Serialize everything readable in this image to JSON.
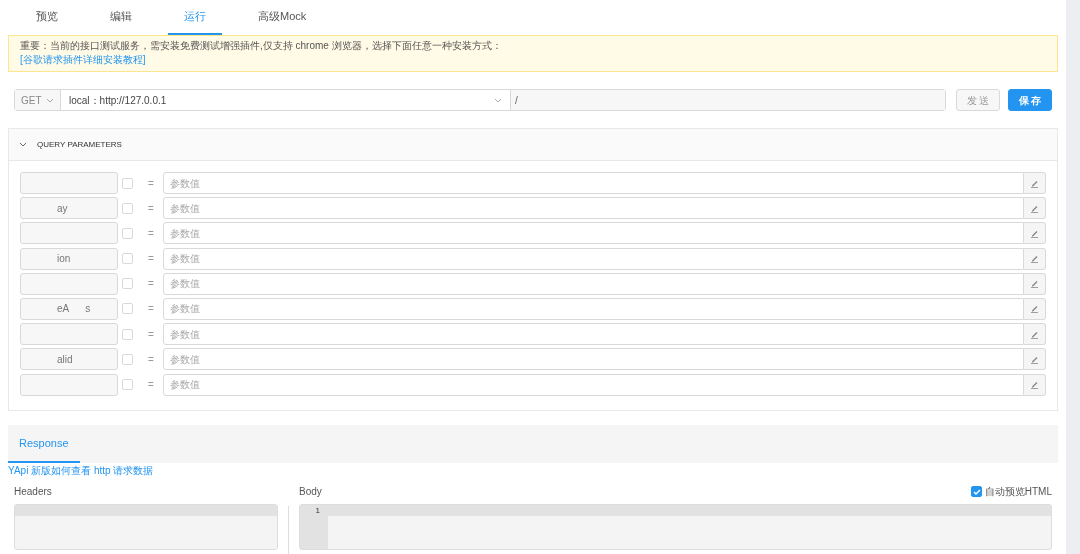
{
  "tabs": [
    {
      "label": "预览",
      "selected": false
    },
    {
      "label": "编辑",
      "selected": false
    },
    {
      "label": "运行",
      "selected": true
    },
    {
      "label": "高级Mock",
      "selected": false
    }
  ],
  "notice": {
    "text": "重要：当前的接口测试服务，需安装免费测试增强插件,仅支持 chrome 浏览器，选择下面任意一种安装方式：",
    "link": "[谷歌请求插件详细安装教程]"
  },
  "request": {
    "method": "GET",
    "env": "local：http://127.0.0.1",
    "path_prefix": "/",
    "send": "发 送",
    "save": "保 存"
  },
  "query": {
    "title": "QUERY PARAMETERS",
    "expanded": true,
    "params": [
      {
        "checked": false,
        "equals": "=",
        "placeholder": "参数值"
      },
      {
        "name": "ay",
        "checked": false,
        "equals": "=",
        "placeholder": "参数值"
      },
      {
        "checked": false,
        "equals": "=",
        "placeholder": "参数值"
      },
      {
        "name": "ion",
        "checked": false,
        "equals": "=",
        "placeholder": "参数值"
      },
      {
        "checked": false,
        "equals": "=",
        "placeholder": "参数值"
      },
      {
        "name": "eA      s",
        "checked": false,
        "equals": "=",
        "placeholder": "参数值"
      },
      {
        "checked": false,
        "equals": "=",
        "placeholder": "参数值"
      },
      {
        "name": "alid",
        "checked": false,
        "equals": "=",
        "placeholder": "参数值"
      },
      {
        "checked": false,
        "equals": "=",
        "placeholder": "参数值"
      }
    ]
  },
  "response": {
    "tab": {
      "label": "Response",
      "selected": true
    },
    "help_link": "YApi 新版如何查看 http 请求数据",
    "headers_label": "Headers",
    "body_label": "Body",
    "auto_preview": {
      "label": "自动预览HTML",
      "checked": true
    },
    "line_numbers": [
      "1"
    ]
  }
}
